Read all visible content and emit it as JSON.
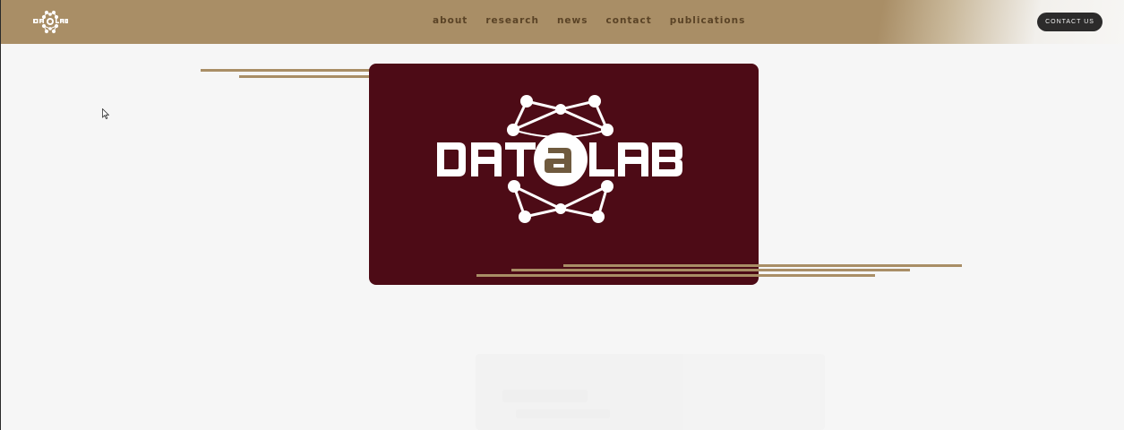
{
  "header": {
    "logo_icon": "datalab-logo-icon",
    "nav": [
      {
        "label": "about"
      },
      {
        "label": "research"
      },
      {
        "label": "news"
      },
      {
        "label": "contact"
      },
      {
        "label": "publications"
      }
    ],
    "contact_button": "CONTACT US"
  },
  "hero": {
    "logo_icon": "datalab-logo-icon",
    "card_color": "#4d0b16"
  },
  "colors": {
    "accent": "#a98e66",
    "header_bg": "#a98e66",
    "nav_text": "#5a4326",
    "button_bg": "#2c2b2b",
    "page_bg": "#f6f6f6"
  }
}
